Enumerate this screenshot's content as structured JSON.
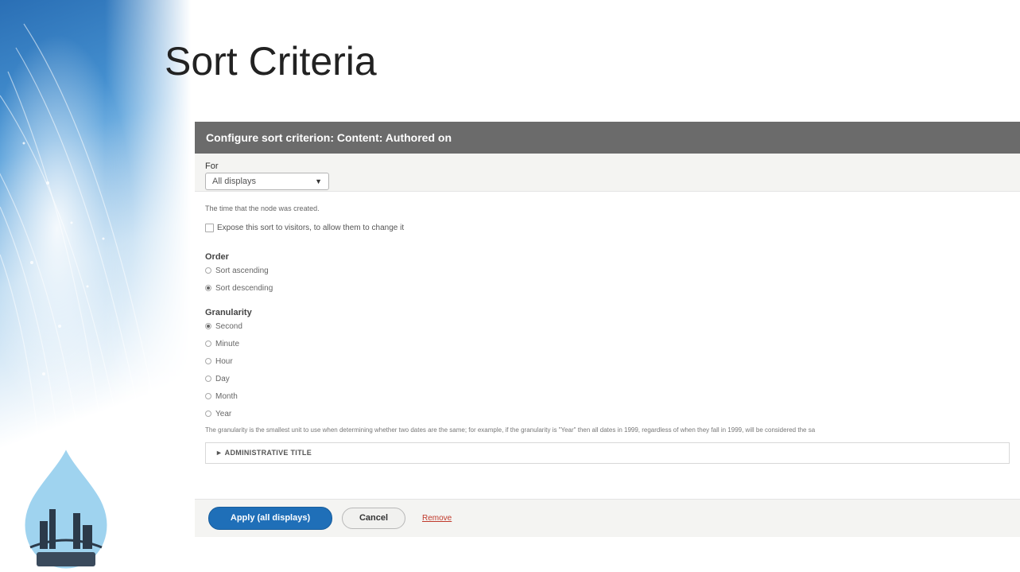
{
  "slide": {
    "title": "Sort Criteria"
  },
  "dialog": {
    "header": "Configure sort criterion: Content: Authored on",
    "for_label": "For",
    "for_select_value": "All displays",
    "description": "The time that the node was created.",
    "expose_label": "Expose this sort to visitors, to allow them to change it",
    "order": {
      "label": "Order",
      "options": [
        {
          "label": "Sort ascending",
          "checked": false
        },
        {
          "label": "Sort descending",
          "checked": true
        }
      ]
    },
    "granularity": {
      "label": "Granularity",
      "options": [
        {
          "label": "Second",
          "checked": true
        },
        {
          "label": "Minute",
          "checked": false
        },
        {
          "label": "Hour",
          "checked": false
        },
        {
          "label": "Day",
          "checked": false
        },
        {
          "label": "Month",
          "checked": false
        },
        {
          "label": "Year",
          "checked": false
        }
      ],
      "description": "The granularity is the smallest unit to use when determining whether two dates are the same; for example, if the granularity is \"Year\" then all dates in 1999, regardless of when they fall in 1999, will be considered the sa"
    },
    "admin_title": "► ADMINISTRATIVE TITLE",
    "actions": {
      "apply": "Apply (all displays)",
      "cancel": "Cancel",
      "remove": "Remove"
    }
  },
  "colors": {
    "header_bg": "#6b6b6b",
    "primary_button": "#1f6fb8",
    "remove_link": "#c0392b"
  }
}
